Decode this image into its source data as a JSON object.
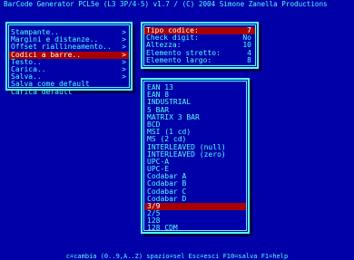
{
  "app": {
    "title": "BarCode Generator PCL5e (L3 3P/4-5) v1.7 / (C) 2004 Simone Zanella Productions"
  },
  "menu": {
    "items": [
      {
        "label": "Stampante..",
        "arrow": ">"
      },
      {
        "label": "Margini e distanze..",
        "arrow": ">"
      },
      {
        "label": "Offset riallineamento..",
        "arrow": ">"
      },
      {
        "label": "Codici a barre..",
        "arrow": ">",
        "selected": true
      },
      {
        "label": "Testo..",
        "arrow": ">"
      },
      {
        "label": "Carica..",
        "arrow": ">"
      },
      {
        "label": "Salva..",
        "arrow": ">"
      },
      {
        "label": "Salva come default",
        "arrow": ""
      },
      {
        "label": "Carica default",
        "arrow": ""
      }
    ]
  },
  "options": {
    "rows": [
      {
        "label": "Tipo codice:",
        "value": "7",
        "selected": true
      },
      {
        "label": "Check digit:",
        "value": "No"
      },
      {
        "label": "Altezza:",
        "value": "10"
      },
      {
        "label": "Elemento stretto:",
        "value": "4"
      },
      {
        "label": "Elemento largo:",
        "value": "8"
      }
    ]
  },
  "barcodes": {
    "items": [
      "EAN 13",
      "EAN 8",
      "INDUSTRIAL",
      "5 BAR",
      "MATRIX 3 BAR",
      "BCD",
      "MSI (1 cd)",
      "MS  (2 cd)",
      "INTERLEAVED (null)",
      "INTERLEAVED (zero)",
      "UPC-A",
      "UPC-E",
      "Codabar A",
      "Codabar B",
      "Codabar C",
      "Codabar D",
      "3/9",
      "2/5",
      "128",
      "128 CDM"
    ],
    "selected_index": 16
  },
  "status": {
    "text": "c=cambia (0..9,A..Z)  spazio=sel  Esc=esci  F10=salva  F1=help"
  },
  "colors": {
    "background": "#0000a8",
    "text": "#55ffff",
    "highlight": "#a80000"
  }
}
